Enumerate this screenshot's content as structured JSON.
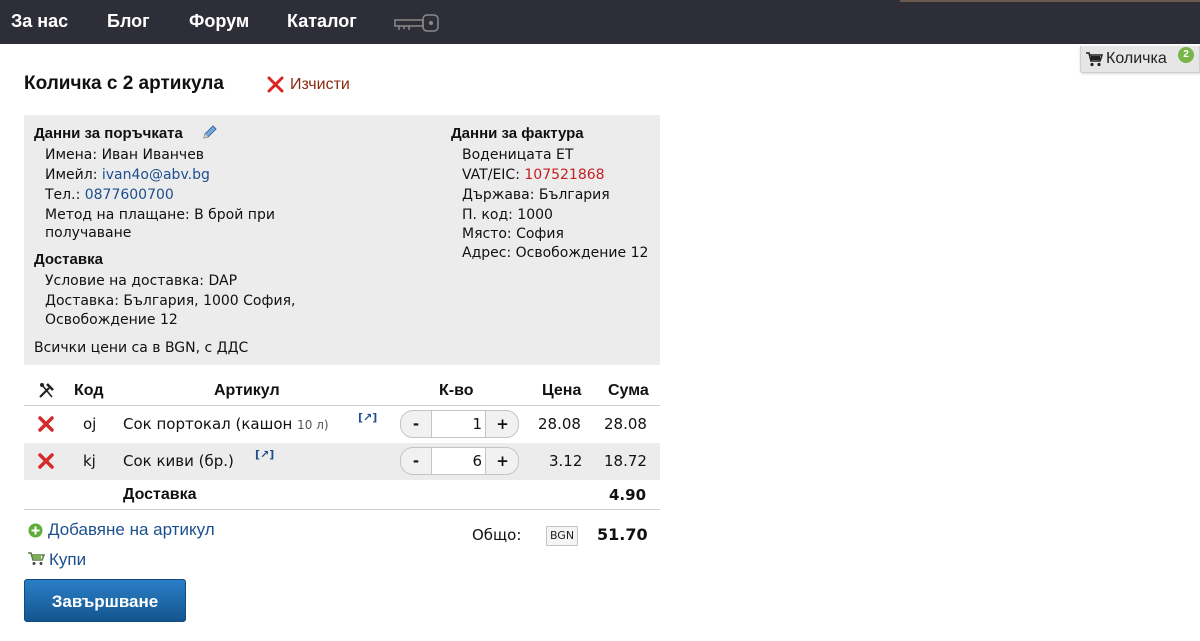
{
  "nav": {
    "items": [
      {
        "label": "За нас"
      },
      {
        "label": "Блог"
      },
      {
        "label": "Форум"
      },
      {
        "label": "Каталог"
      }
    ],
    "key_icon": "key-icon"
  },
  "cart_tab": {
    "label": "Количка",
    "count": "2",
    "icon": "cart-icon"
  },
  "page": {
    "title": "Количка с 2 артикула",
    "clear_label": "Изчисти"
  },
  "order": {
    "heading": "Данни за поръчката",
    "name_label": "Имена:",
    "name": "Иван Иванчев",
    "email_label": "Имейл:",
    "email": "ivan4o@abv.bg",
    "phone_label": "Тел.:",
    "phone": "0877600700",
    "payment_line1": "Метод на плащане: В брой при",
    "payment_line2": "получаване"
  },
  "delivery": {
    "heading": "Доставка",
    "condition": "Условие на доставка: DAP",
    "address_line1": "Доставка: България, 1000 София,",
    "address_line2": "Освобождение 12"
  },
  "prices_note": "Всички цени са в BGN, с ДДС",
  "invoice": {
    "heading": "Данни за фактура",
    "company": "Воденицата ЕТ",
    "vat_label": "VAT/EIC:",
    "vat": "107521868",
    "country": "Държава: България",
    "postcode": "П. код: 1000",
    "city": "Място: София",
    "address": "Адрес: Освобождение 12"
  },
  "table": {
    "headers": {
      "code": "Код",
      "item": "Артикул",
      "qty": "К-во",
      "price": "Цена",
      "sum": "Сума"
    },
    "rows": [
      {
        "code": "oj",
        "name": "Сок портокал (кашон",
        "unit": "10 л)",
        "ext": "[↗]",
        "qty": "1",
        "price": "28.08",
        "sum": "28.08"
      },
      {
        "code": "kj",
        "name": "Сок киви (бр.)",
        "unit": "",
        "ext": "[↗]",
        "qty": "6",
        "price": "3.12",
        "sum": "18.72"
      }
    ],
    "minus": "-",
    "plus": "+",
    "delivery_label": "Доставка",
    "delivery_value": "4.90"
  },
  "footer": {
    "add_item": "Добавяне на артикул",
    "buy": "Купи",
    "total_label": "Общо:",
    "currency": "BGN",
    "total": "51.70",
    "finish": "Завършване"
  }
}
